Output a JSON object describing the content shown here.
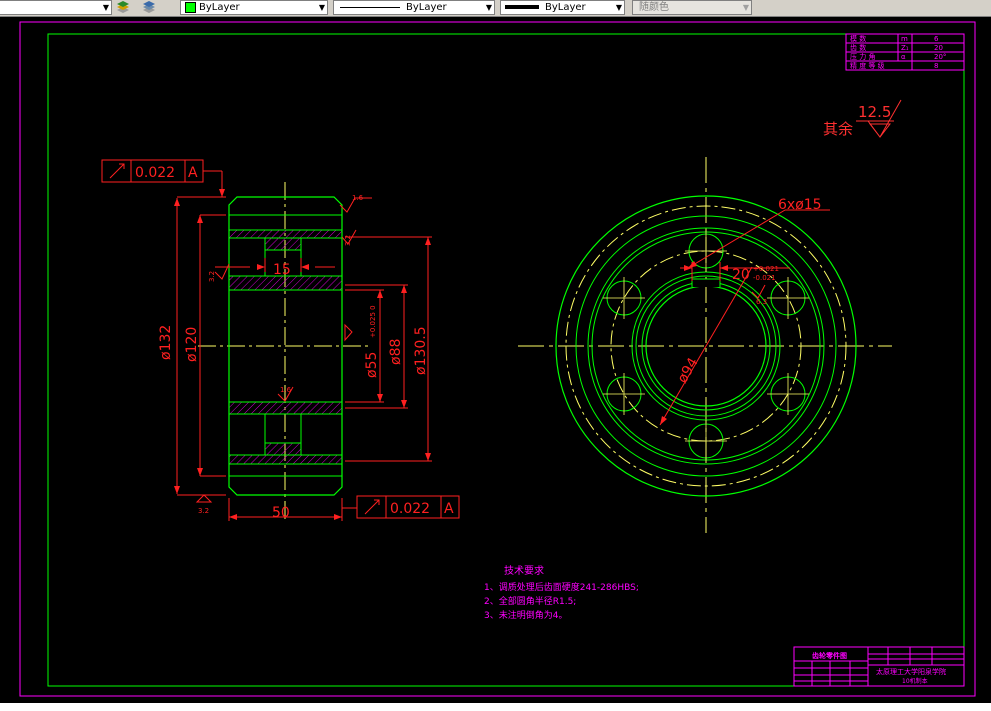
{
  "toolbar": {
    "layer_value": "",
    "color_value": "ByLayer",
    "linetype_value": "ByLayer",
    "lineweight_value": "ByLayer",
    "plotstyle_value": "随颜色"
  },
  "drawing": {
    "tolerance_top_value": "0.022",
    "tolerance_top_datum": "A",
    "tolerance_bottom_value": "0.022",
    "tolerance_bottom_datum": "A",
    "dim_d132": "ø132",
    "dim_d120": "ø120",
    "dim_d55": "ø55",
    "dim_d55_tol": "+0.025 0",
    "dim_d88": "ø88",
    "dim_d130_5": "ø130.5",
    "dim_hub_width": "15",
    "dim_width": "50",
    "dim_holes": "6xø15",
    "dim_keyway": "20",
    "dim_keyway_tol_upper": "+0.021",
    "dim_keyway_tol_lower": "-0.021",
    "dim_bore": "ø94",
    "rough_top": "1.6",
    "rough_right": "3.2",
    "rough_left": "3.2",
    "rough_bottom": "3.2",
    "rough_bore": "1.6",
    "rough_keyway": "6.3",
    "rough_other_value": "12.5",
    "rough_other_label": "其余",
    "gear_params": [
      {
        "name": "模 数",
        "symbol": "m",
        "value": "6"
      },
      {
        "name": "齿 数",
        "symbol": "Z₁",
        "value": "20"
      },
      {
        "name": "压 力 角",
        "symbol": "α",
        "value": "20°"
      },
      {
        "name": "精 度 等 级",
        "symbol": "",
        "value": "8"
      }
    ],
    "tech_title": "技术要求",
    "tech_items": [
      "1、调质处理后齿面硬度241-286HBS;",
      "2、全部圆角半径R1.5;",
      "3、未注明倒角为4。"
    ],
    "title_block_name": "齿轮零件图",
    "title_block_school": "太原理工大学阳泉学院",
    "title_block_class": "10机制本"
  }
}
